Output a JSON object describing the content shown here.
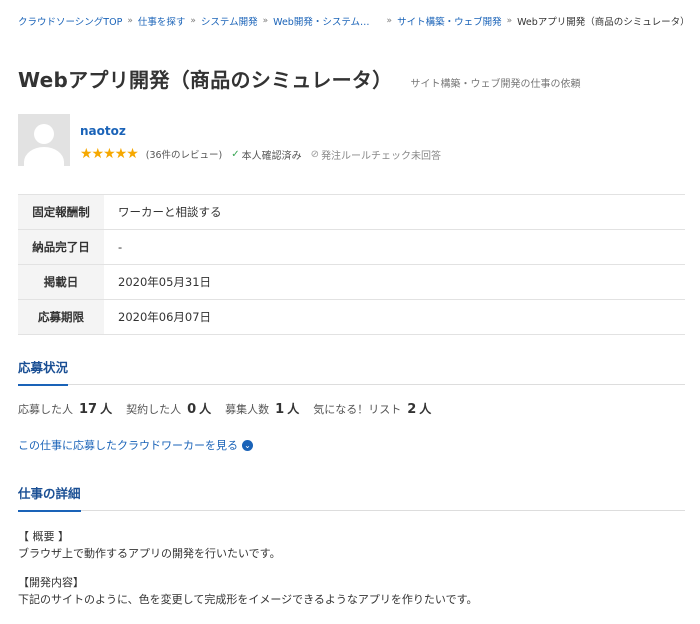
{
  "breadcrumb": {
    "items": [
      "クラウドソーシングTOP",
      "仕事を探す",
      "システム開発",
      "Web開発・システム…",
      "サイト構築・ウェブ開発"
    ],
    "current": "Webアプリ開発（商品のシミュレータ）",
    "separator": "»"
  },
  "job": {
    "title": "Webアプリ開発（商品のシミュレータ）",
    "subtitle": "サイト構築・ウェブ開発の仕事の依頼"
  },
  "client": {
    "name": "naotoz",
    "stars": "★★★★★",
    "review_count": "(36件のレビュー)",
    "verified_icon": "✓",
    "verified": "本人確認済み",
    "unanswered_icon": "⊘",
    "rule_check": "発注ルールチェック未回答"
  },
  "details": [
    {
      "label": "固定報酬制",
      "value": "ワーカーと相談する"
    },
    {
      "label": "納品完了日",
      "value": "-"
    },
    {
      "label": "掲載日",
      "value": "2020年05月31日"
    },
    {
      "label": "応募期限",
      "value": "2020年06月07日"
    }
  ],
  "application_status": {
    "heading": "応募状況",
    "stats": [
      {
        "label": "応募した人",
        "value": "17",
        "unit": "人"
      },
      {
        "label": "契約した人",
        "value": "0",
        "unit": "人"
      },
      {
        "label": "募集人数",
        "value": "1",
        "unit": "人"
      },
      {
        "label": "気になる！リスト",
        "value": "2",
        "unit": "人"
      }
    ],
    "workers_link": "この仕事に応募したクラウドワーカーを見る"
  },
  "job_details": {
    "heading": "仕事の詳細",
    "overview_heading": "【 概要 】",
    "overview_text": "ブラウザ上で動作するアプリの開発を行いたいです。",
    "content_heading": "【開発内容】",
    "content_text": "下記のサイトのように、色を変更して完成形をイメージできるようなアプリを作りたいです。"
  },
  "colors": {
    "link": "#1a63b8",
    "star": "#f6a800",
    "verified": "#3aa655"
  }
}
